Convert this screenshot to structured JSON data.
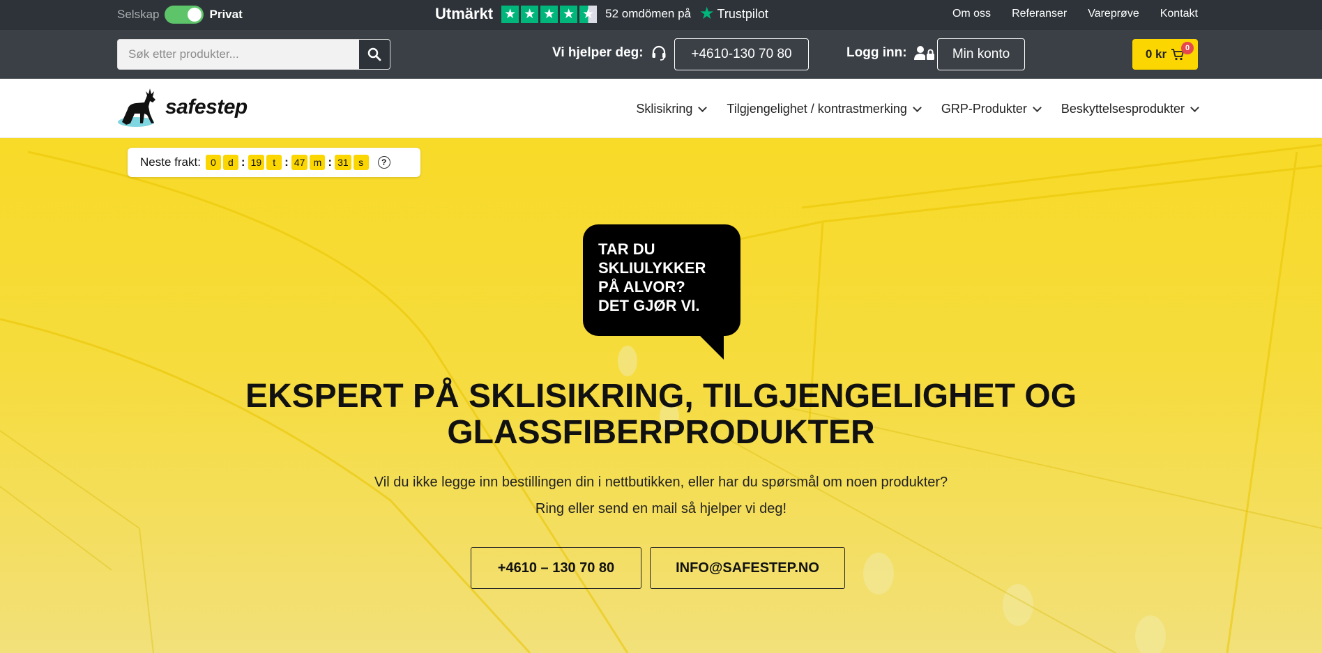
{
  "topbar": {
    "toggle_left": "Selskap",
    "toggle_right": "Privat",
    "trustpilot_word": "Utmärkt",
    "trustpilot_reviews": "52 omdömen på",
    "trustpilot_brand": "Trustpilot",
    "rating": 4.5,
    "links": [
      "Om oss",
      "Referanser",
      "Vareprøve",
      "Kontakt"
    ]
  },
  "bar2": {
    "search_placeholder": "Søk etter produkter...",
    "help_label": "Vi hjelper deg:",
    "phone": "+4610-130 70 80",
    "login_label": "Logg inn:",
    "account": "Min konto",
    "cart_total": "0 kr",
    "cart_count": "0"
  },
  "nav": {
    "logo_text": "safestep",
    "menu": [
      "Sklisikring",
      "Tilgjengelighet / kontrastmerking",
      "GRP-Produkter",
      "Beskyttelsesprodukter"
    ]
  },
  "countdown": {
    "label": "Neste frakt:",
    "days": "0",
    "d": "d",
    "hours": "19",
    "t": "t",
    "minutes": "47",
    "m": "m",
    "seconds": "31",
    "s": "s",
    "help": "?"
  },
  "hero": {
    "bubble_lines": [
      "TAR DU",
      "SKLIULYKKER",
      "PÅ ALVOR?",
      "DET GJØR VI."
    ],
    "headline_1": "EKSPERT PÅ SKLISIKRING, TILGJENGELIGHET OG",
    "headline_2": "GLASSFIBERPRODUKTER",
    "sub_1": "Vil du ikke legge inn bestillingen din i nettbutikken, eller har du spørsmål om noen produkter?",
    "sub_2": "Ring eller send en mail så hjelper vi deg!",
    "cta_phone": "+4610 – 130 70 80",
    "cta_mail": "INFO@SAFESTEP.NO"
  },
  "colors": {
    "topbar": "#2d3338",
    "bar2": "#3a4046",
    "accent_yellow": "#fbd600",
    "toggle_green": "#5ec46a",
    "trustpilot_green": "#00b67a"
  }
}
